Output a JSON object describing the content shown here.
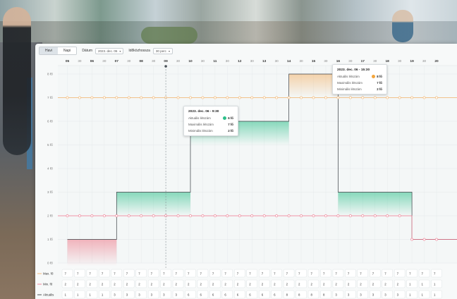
{
  "toolbar": {
    "tab_monthly": "Havi",
    "tab_daily": "Napi",
    "date_label": "Dátum",
    "date_value": "2023. dec. 06",
    "interval_label": "Időközhossza",
    "interval_value": "30 perc"
  },
  "colors": {
    "max_line": "#f3b36b",
    "min_line": "#ef7a8f",
    "current_line": "#3c4046",
    "fill_green": "#2dbf8a",
    "fill_orange": "#f3b36b",
    "fill_red": "#ee7b8b"
  },
  "chart_data": {
    "type": "line",
    "x": [
      "05",
      "",
      "06",
      "",
      "07",
      "",
      "08",
      "",
      "09",
      "",
      "10",
      "",
      "11",
      "",
      "12",
      "",
      "13",
      "",
      "14",
      "",
      "15",
      "",
      "16",
      "",
      "17",
      "",
      "18",
      "",
      "19",
      "",
      "20"
    ],
    "y_ticks": [
      "0 fő",
      "1 fő",
      "2 fő",
      "3 fő",
      "4 fő",
      "5 fő",
      "6 fő",
      "7 fő",
      "8 fő"
    ],
    "ylim": [
      0,
      8
    ],
    "series": [
      {
        "name": "Max. fő",
        "values": [
          7,
          7,
          7,
          7,
          7,
          7,
          7,
          7,
          7,
          7,
          7,
          7,
          7,
          7,
          7,
          7,
          7,
          7,
          7,
          7,
          7,
          7,
          7,
          7,
          7,
          7,
          7,
          7,
          7,
          7,
          7
        ]
      },
      {
        "name": "Min. fő",
        "values": [
          2,
          2,
          2,
          2,
          2,
          2,
          2,
          2,
          2,
          2,
          2,
          2,
          2,
          2,
          2,
          2,
          2,
          2,
          2,
          2,
          2,
          2,
          2,
          2,
          2,
          2,
          2,
          2,
          1,
          1,
          1
        ]
      },
      {
        "name": "Aktuális",
        "values": [
          1,
          1,
          1,
          1,
          3,
          3,
          3,
          3,
          3,
          3,
          6,
          6,
          6,
          6,
          6,
          6,
          6,
          6,
          8,
          8,
          8,
          8,
          3,
          3,
          3,
          3,
          3,
          3,
          1,
          1,
          1
        ]
      }
    ]
  },
  "tooltip1": {
    "title": "2023. dec. 06 - 9:30",
    "current_label": "Aktuális létszám",
    "current_value": "6 fő",
    "max_label": "Maximális létszám",
    "max_value": "7 fő",
    "min_label": "Minimális létszám",
    "min_value": "2 fő"
  },
  "tooltip2": {
    "title": "2023. dec. 06 - 15:30",
    "current_label": "Aktuális létszám",
    "current_value": "8 fő",
    "max_label": "Maximális létszám",
    "max_value": "7 fő",
    "min_label": "Minimális létszám",
    "min_value": "2 fő"
  }
}
